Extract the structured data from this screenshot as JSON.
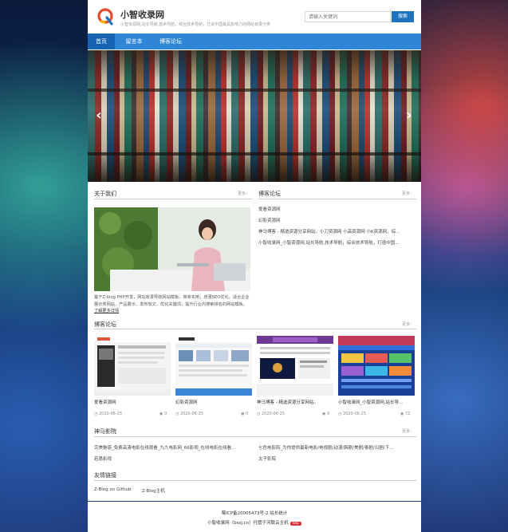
{
  "site": {
    "title": "小智收录网",
    "description": "小智资源网,站长导航,技术导航，综合技术导航，打造中国最具影响力的网站目录分类",
    "search_placeholder": "请输入关键词",
    "search_button": "搜索"
  },
  "nav": {
    "items": [
      "首页",
      "留言本",
      "博客论坛"
    ]
  },
  "about": {
    "title": "关于我们",
    "more": "更多›",
    "text": "基于Z-blog PHP开发，网站收录导航网站模板，简单实用，增强SEO优化，适合企业展示类网站，产品展示、发布软文，优化关键词，提升行业内搜索排名的网站模板。",
    "more_link": "了解更多详情"
  },
  "forum": {
    "title": "博客论坛",
    "more": "更多›",
    "items": [
      "爱看资源网",
      "幻影资源网",
      "神马博客 - 精选资源分享网站。小刀资源网 小高资源网 小K资源网，综...",
      "小智收录网_小智资源网,站长导航,技术导航，综合技术导航，打造中国..."
    ]
  },
  "blog": {
    "title": "博客论坛",
    "more": "更多›",
    "cards": [
      {
        "title": "爱看资源网",
        "date": "2020-06-25",
        "views": "0"
      },
      {
        "title": "幻影资源网",
        "date": "2020-06-25",
        "views": "0"
      },
      {
        "title": "神马博客 - 精选资源分享网站。",
        "date": "2020-06-25",
        "views": "9"
      },
      {
        "title": "小智收录网_小智资源网,站长导...",
        "date": "2020-06-25",
        "views": "72"
      }
    ]
  },
  "movies": {
    "title": "神马影院",
    "more": "更多›",
    "left": [
      "完美魅惑_免费高清电影在线观看_九九电影网_66影视_在线电影在线看...",
      "若愚影视"
    ],
    "right": [
      "七色电影院_为你提供最新电影/电视剧/动漫/韩剧/美剧/泰剧/日剧/下...",
      "太子影院"
    ]
  },
  "links": {
    "title": "友情链接",
    "items": [
      "Z-Blog on Github",
      "Z-Blog主机"
    ]
  },
  "footer": {
    "icp": "蜀ICP备20005473号-2 站长统计",
    "copyright": "小智收录网（bssj.cn）托管于河联云主机",
    "ssl": "SSL"
  },
  "colors": {
    "accent": "#2f86d6",
    "nav_active": "#1764b4"
  }
}
